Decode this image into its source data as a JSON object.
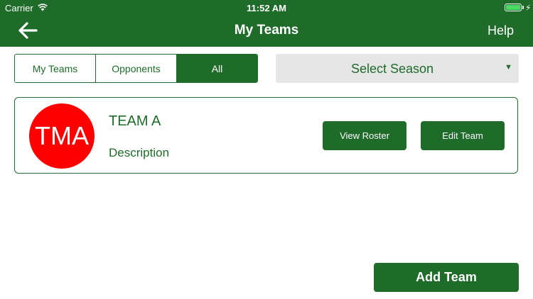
{
  "status_bar": {
    "carrier": "Carrier",
    "time": "11:52 AM",
    "battery_level": 1.0
  },
  "nav": {
    "title": "My Teams",
    "help_label": "Help",
    "back_icon": "arrow-left-icon"
  },
  "filter": {
    "segments": [
      {
        "label": "My Teams",
        "active": false
      },
      {
        "label": "Opponents",
        "active": false
      },
      {
        "label": "All",
        "active": true
      }
    ]
  },
  "season": {
    "label": "Select Season"
  },
  "teams": [
    {
      "avatar_text": "TMA",
      "avatar_color": "#ff0000",
      "name": "TEAM A",
      "description": "Description",
      "view_roster_label": "View Roster",
      "edit_team_label": "Edit Team"
    }
  ],
  "footer": {
    "add_team_label": "Add Team"
  },
  "colors": {
    "brand_green": "#1e6b2a",
    "season_bg": "#e6e6e6",
    "battery_fill": "#4cd964"
  }
}
